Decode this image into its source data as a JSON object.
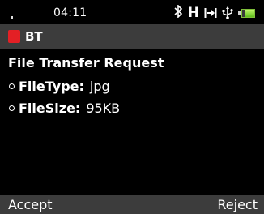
{
  "status_bar": {
    "time": "04:11",
    "icons": {
      "signal": "signal-dot-icon",
      "bluetooth": "bluetooth-icon",
      "network": "h-network-icon",
      "transfer": "transfer-arrow-icon",
      "usb": "usb-icon",
      "battery": "battery-icon"
    },
    "bluetooth_glyph": "∦",
    "network_label": "H",
    "battery_level": 0.75,
    "battery_color": "#7fbf3a"
  },
  "title_bar": {
    "title": "BT",
    "accent_color": "#e32025"
  },
  "content": {
    "heading": "File Transfer Request",
    "items": [
      {
        "label": "FileType:",
        "value": "jpg"
      },
      {
        "label": "FileSize:",
        "value": "95KB"
      }
    ]
  },
  "softkeys": {
    "left": "Accept",
    "right": "Reject"
  }
}
